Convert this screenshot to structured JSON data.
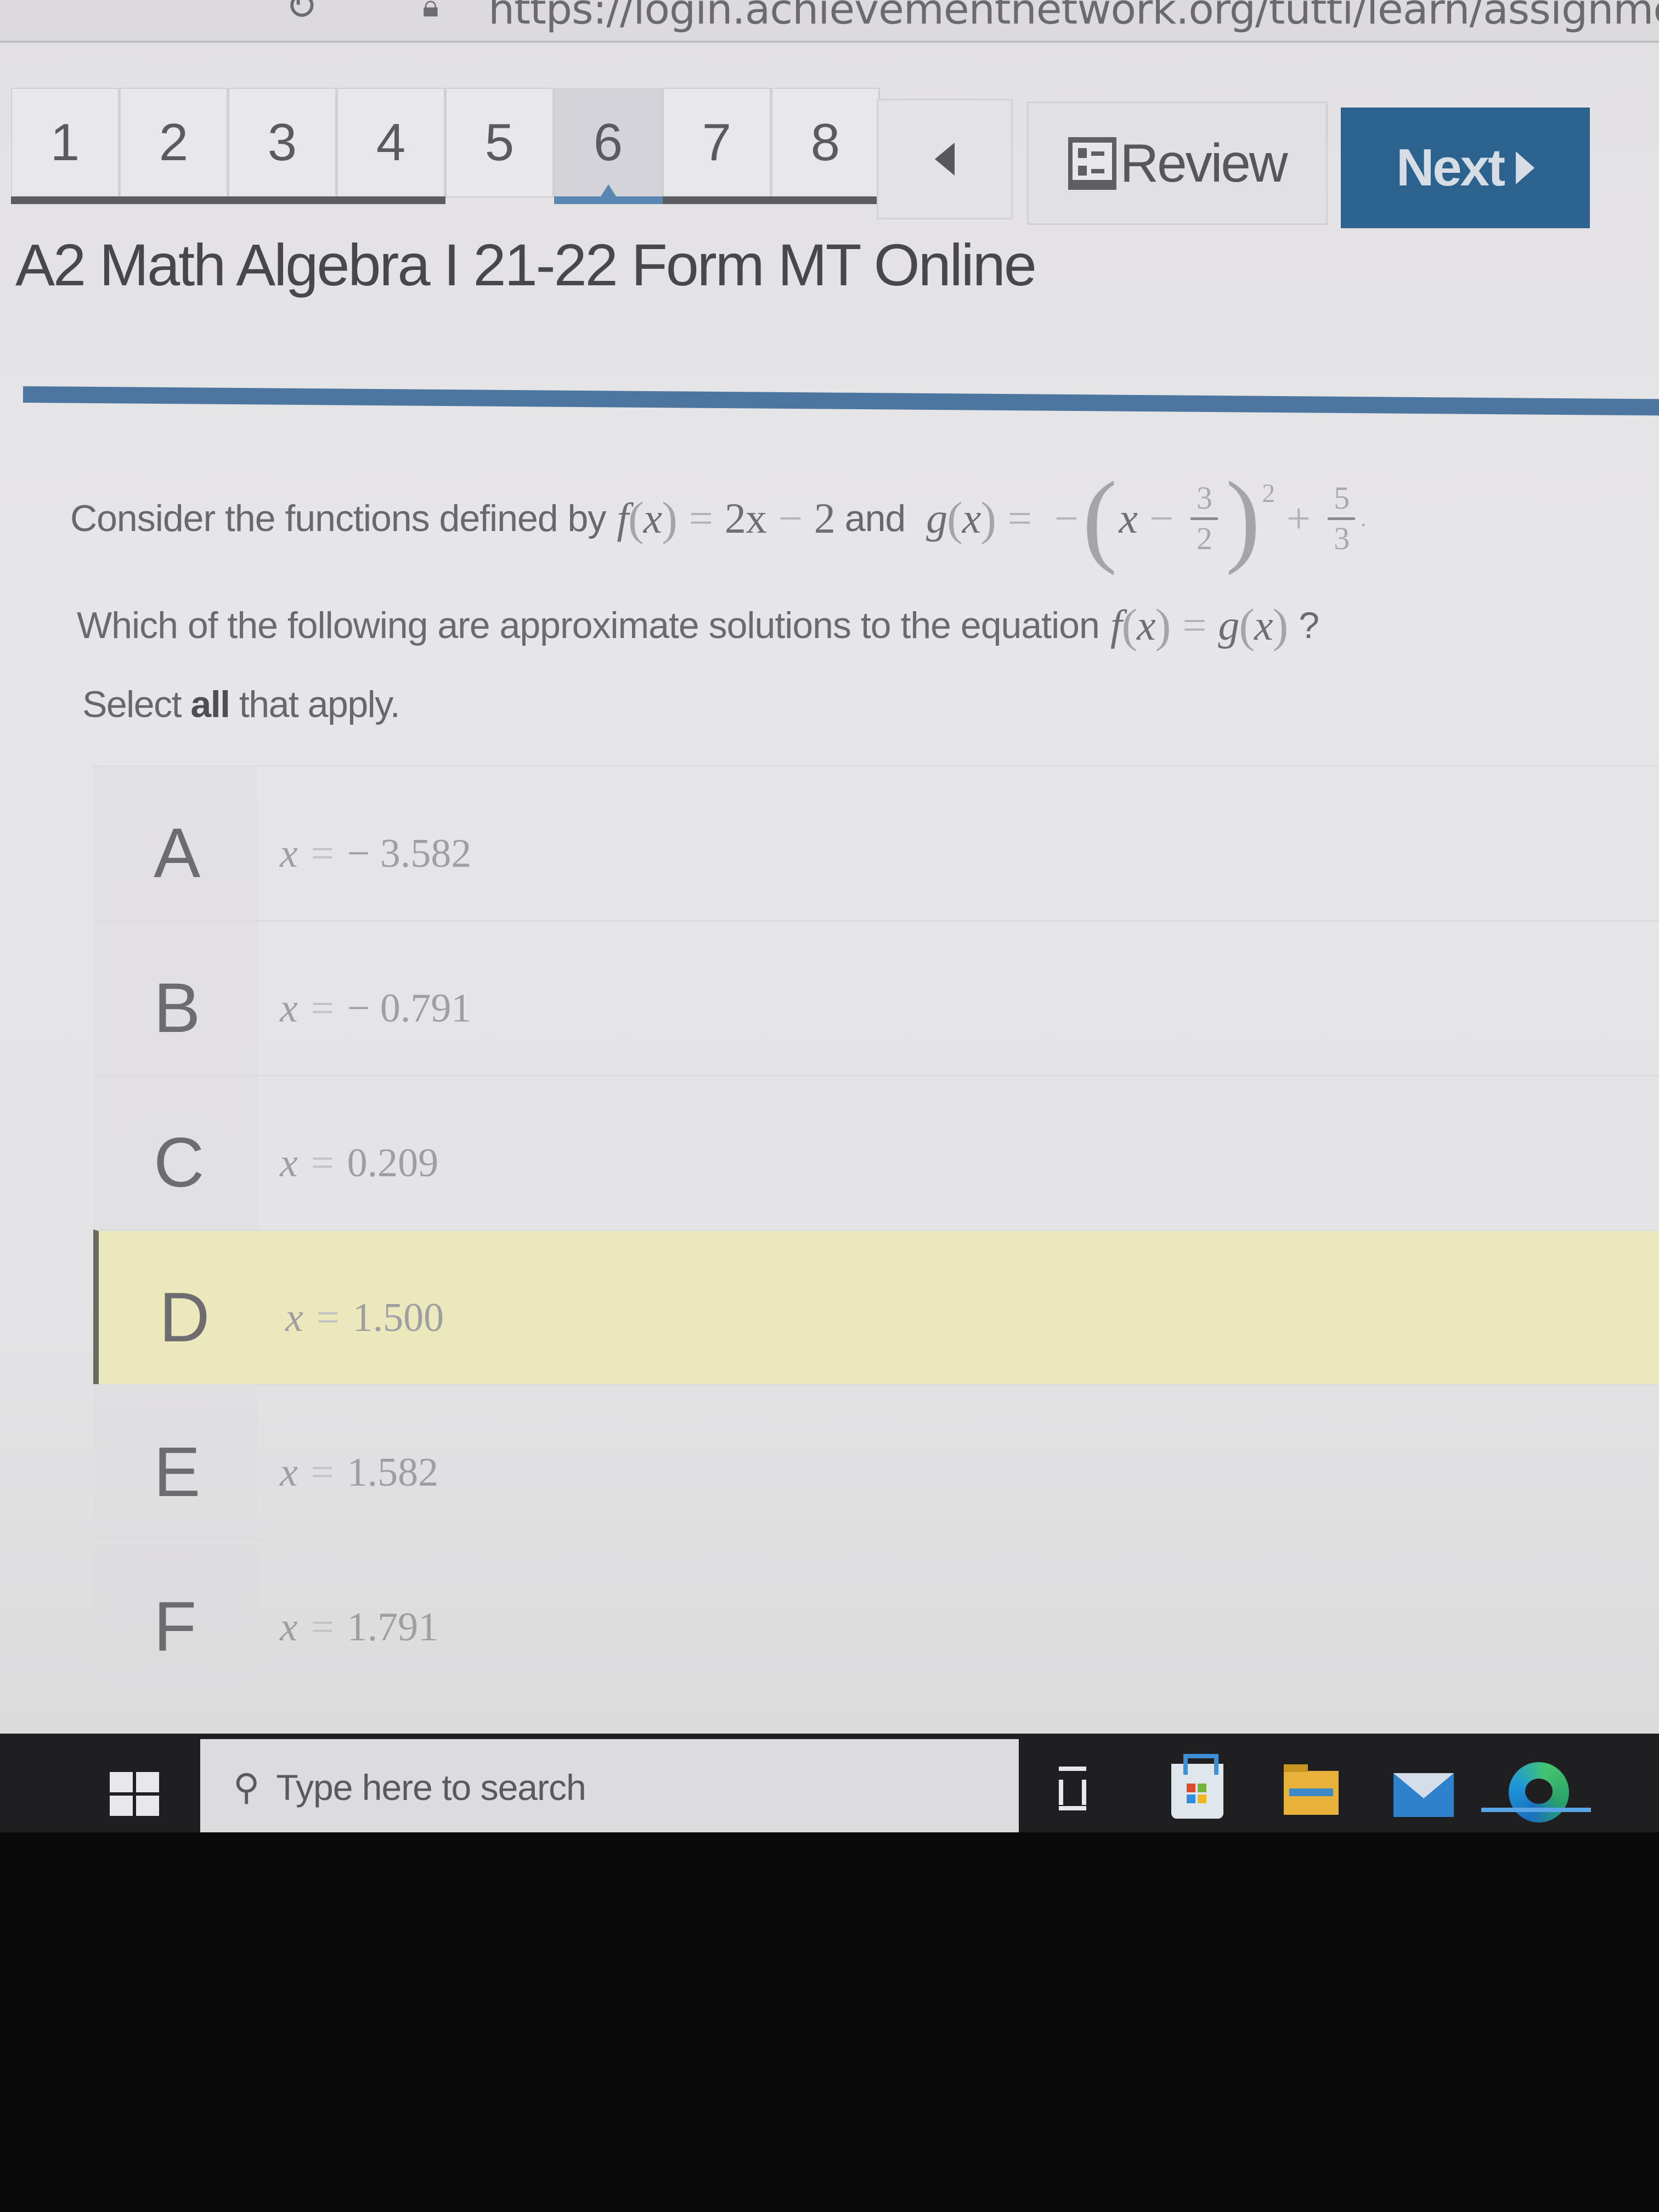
{
  "browser": {
    "url": "https://login.achievementnetwork.org/tutti/learn/assignments/viewAs",
    "reload_icon": "reload-icon",
    "lock_icon": "lock-icon"
  },
  "question_nav": {
    "questions": [
      "1",
      "2",
      "3",
      "4",
      "5",
      "6",
      "7",
      "8"
    ],
    "current": "6",
    "prev_icon": "triangle-left-icon",
    "review_label": "Review",
    "review_icon": "review-list-icon",
    "next_label": "Next",
    "next_icon": "triangle-right-icon",
    "accent_color": "#2c628e"
  },
  "test_title": "A2 Math Algebra I 21-22 Form MT Online",
  "question": {
    "intro": "Consider the functions defined by",
    "f_name": "f",
    "var": "x",
    "f_rhs_a": "2x",
    "minus": "−",
    "f_rhs_b": "2",
    "and": " and ",
    "g_name": "g",
    "eq": "=",
    "neg": "−",
    "frac1_num": "3",
    "frac1_den": "2",
    "exponent": "2",
    "plus": "+",
    "frac2_num": "5",
    "frac2_den": "3",
    "period": ".",
    "ask": "Which of the following are approximate solutions to the equation",
    "qmark": "?",
    "instruction_pre": "Select ",
    "instruction_bold": "all",
    "instruction_post": " that apply."
  },
  "options": [
    {
      "letter": "A",
      "var": "x",
      "eq": "=",
      "value": "− 3.582",
      "selected": false
    },
    {
      "letter": "B",
      "var": "x",
      "eq": "=",
      "value": "− 0.791",
      "selected": false
    },
    {
      "letter": "C",
      "var": "x",
      "eq": "=",
      "value": "0.209",
      "selected": false
    },
    {
      "letter": "D",
      "var": "x",
      "eq": "=",
      "value": "1.500",
      "selected": true
    },
    {
      "letter": "E",
      "var": "x",
      "eq": "=",
      "value": "1.582",
      "selected": false
    },
    {
      "letter": "F",
      "var": "x",
      "eq": "=",
      "value": "1.791",
      "selected": false
    }
  ],
  "selected_color": "#ebe8bc",
  "taskbar": {
    "search_placeholder": "Type here to search",
    "icons": [
      "windows-start-icon",
      "search-icon",
      "task-view-icon",
      "microsoft-store-icon",
      "file-explorer-icon",
      "mail-icon",
      "edge-icon"
    ]
  }
}
